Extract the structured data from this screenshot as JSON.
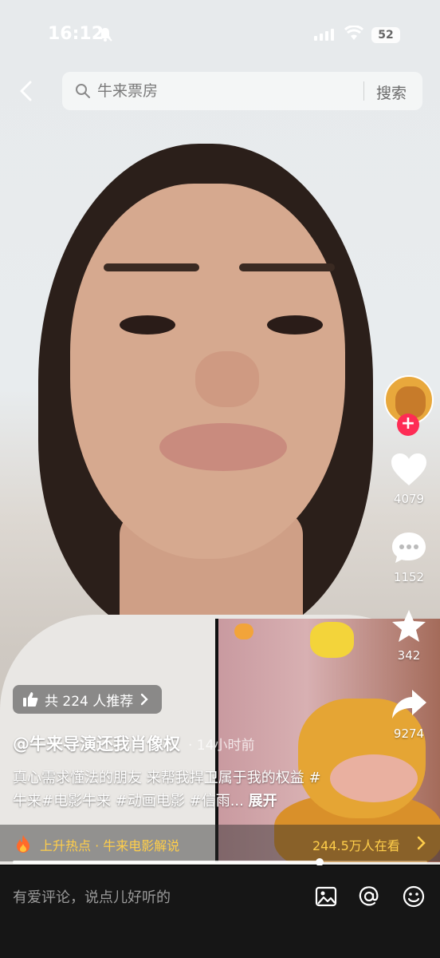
{
  "status_bar": {
    "time": "16:12",
    "battery": "52",
    "icons": [
      "bell-slash-icon",
      "signal-icon",
      "wifi-icon",
      "battery-icon"
    ]
  },
  "search": {
    "placeholder": "牛来票房",
    "button_label": "搜索"
  },
  "actions": {
    "likes": "4079",
    "comments": "1152",
    "favorites": "342",
    "shares": "9274"
  },
  "recommend_label": "共 224 人推荐",
  "author": "@牛来导演还我肖像权",
  "time_ago": "· 14小时前",
  "description": "真心需求懂法的朋友 来帮我捍卫属于我的权益 #牛来#电影牛来 #动画电影 #信雨...",
  "expand_label": "展开",
  "hot_bar": {
    "text": "上升热点 · 牛来电影解说",
    "watching": "244.5万人在看"
  },
  "playback": {
    "progress_fraction": 0.74
  },
  "comment_input": {
    "placeholder": "有爱评论，说点儿好听的"
  },
  "colors": {
    "follow": "#fe2c55",
    "hot_text": "#ffce4a"
  }
}
